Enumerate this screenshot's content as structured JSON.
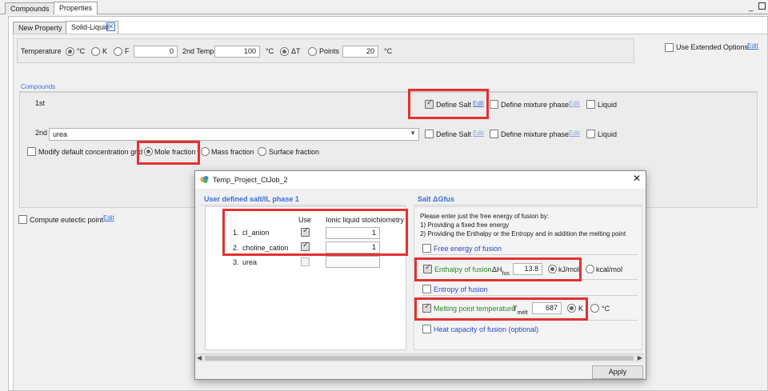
{
  "top_tabs": [
    "Compounds",
    "Properties"
  ],
  "sub_tabs": {
    "new_property": "New Property",
    "solid_liquid": "Solid-Liquid"
  },
  "window_controls": {
    "minimize": "_",
    "maximize": "□"
  },
  "temperature": {
    "label": "Temperature",
    "unit_c": "°C",
    "unit_k": "K",
    "unit_f": "F",
    "value": "0",
    "second_label": "2nd Temp",
    "second_value": "100",
    "second_unit": "°C",
    "delta": "ΔT",
    "points_label": "Points",
    "points_value": "20",
    "step_unit": "°C"
  },
  "extended": {
    "label": "Use Extended Options",
    "edit": "Edit"
  },
  "compounds": {
    "heading": "Compounds",
    "first": {
      "label": "1st",
      "define_salt": "Define Salt",
      "edit": "Edit",
      "define_mixture": "Define mixture phase",
      "edit2": "Edit",
      "liquid": "Liquid"
    },
    "second": {
      "label": "2nd",
      "value": "urea",
      "define_salt": "Define Salt",
      "edit": "Edit",
      "define_mixture": "Define mixture phase",
      "edit2": "Edit",
      "liquid": "Liquid"
    },
    "modify_grid": "Modify default concentration grid",
    "mole_fraction": "Mole fraction",
    "mass_fraction": "Mass fraction",
    "surface_fraction": "Surface fraction"
  },
  "eutectic": {
    "label": "Compute eutectic point",
    "edit": "Edit"
  },
  "dialog": {
    "title": "Temp_Project_CtJob_2",
    "close": "✕",
    "left_heading": "User defined salt/IL phase 1",
    "col_use": "Use",
    "col_stoich": "Ionic liquid stoichiometry",
    "rows": [
      {
        "num": "1.",
        "name": "cl_anion",
        "value": "1"
      },
      {
        "num": "2.",
        "name": "choline_cation",
        "value": "1"
      },
      {
        "num": "3.",
        "name": "urea",
        "value": ""
      }
    ],
    "right_heading": "Salt ΔGfus",
    "instructions": [
      "Please enter just the free energy of fusion by:",
      "1) Providing a fixed free energy",
      "2) Providing the Enthalpy or the Entropy and in addition the melting point"
    ],
    "free_energy": "Free energy of fusion",
    "enthalpy": {
      "label": "Enthalpy of fusion",
      "symbol": "ΔH",
      "sub": "fus",
      "value": "13.8",
      "unit1": "kJ/mol",
      "unit2": "kcal/mol"
    },
    "entropy": "Entropy of fusion",
    "melting": {
      "label": "Melting point temperature",
      "symbol": "T",
      "sub": "melt",
      "value": "687",
      "unit1": "K",
      "unit2": "°C"
    },
    "heat_capacity": "Heat capacity of fusion (optional)",
    "apply": "Apply"
  }
}
